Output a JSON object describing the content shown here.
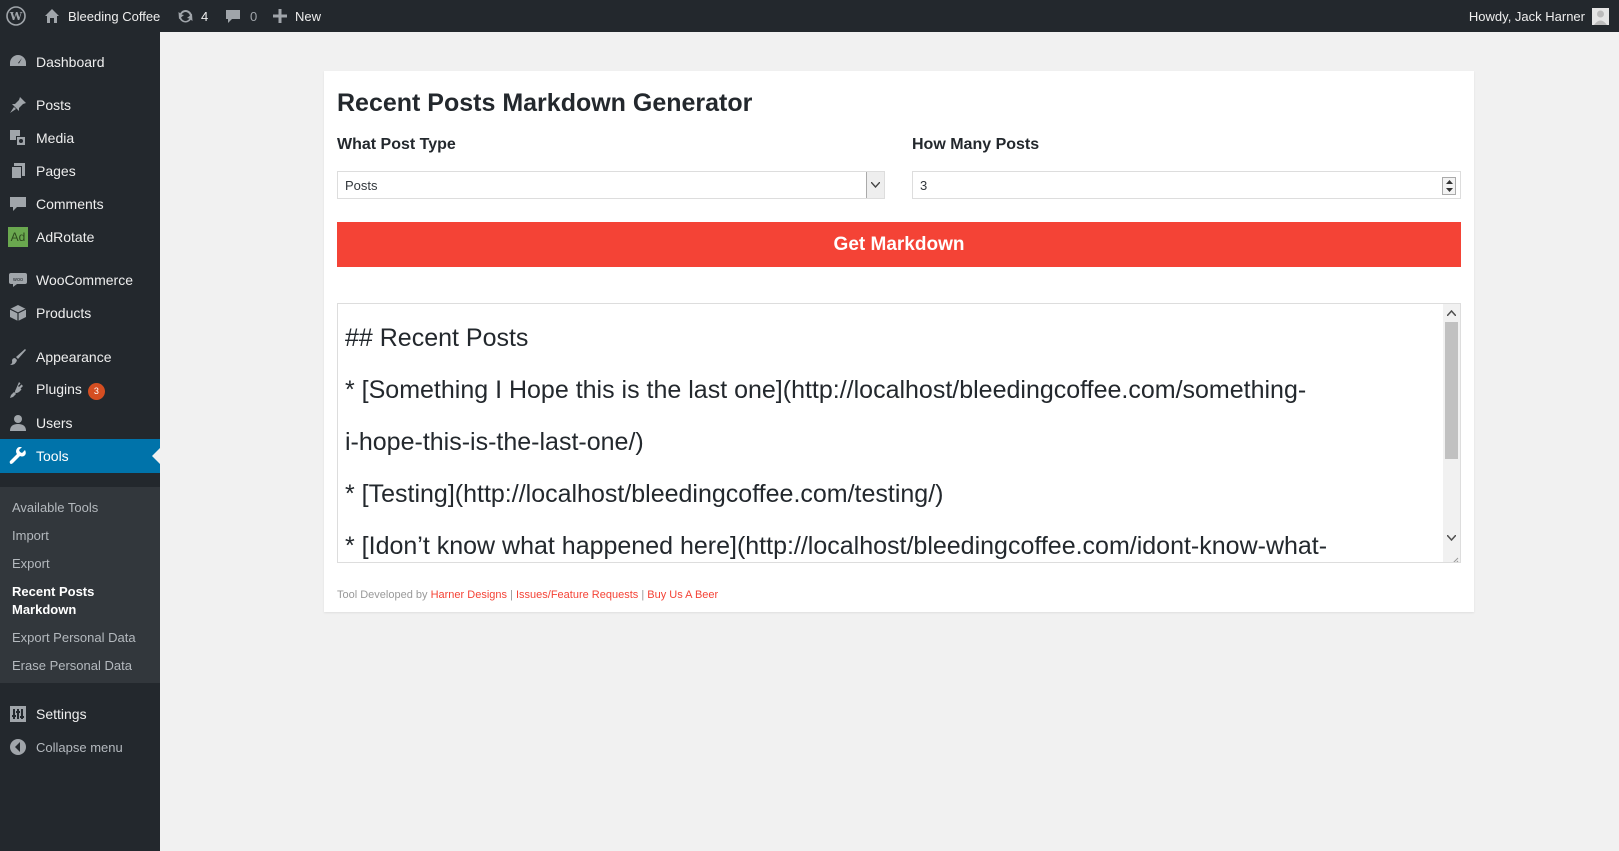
{
  "adminbar": {
    "site_name": "Bleeding Coffee",
    "updates_count": "4",
    "comments_count": "0",
    "new_label": "New",
    "greeting": "Howdy, Jack Harner"
  },
  "sidebar": {
    "items": [
      {
        "label": "Dashboard",
        "icon": "dashboard-icon"
      },
      {
        "label": "Posts",
        "icon": "pin-icon"
      },
      {
        "label": "Media",
        "icon": "media-icon"
      },
      {
        "label": "Pages",
        "icon": "pages-icon"
      },
      {
        "label": "Comments",
        "icon": "comment-icon"
      },
      {
        "label": "AdRotate",
        "icon": "adrotate-icon"
      },
      {
        "label": "WooCommerce",
        "icon": "woocommerce-icon"
      },
      {
        "label": "Products",
        "icon": "box-icon"
      },
      {
        "label": "Appearance",
        "icon": "brush-icon"
      },
      {
        "label": "Plugins",
        "icon": "plug-icon",
        "badge": "3"
      },
      {
        "label": "Users",
        "icon": "user-icon"
      },
      {
        "label": "Tools",
        "icon": "wrench-icon",
        "current": true
      },
      {
        "label": "Settings",
        "icon": "settings-icon"
      },
      {
        "label": "Collapse menu",
        "icon": "collapse-icon"
      }
    ],
    "submenu": [
      {
        "label": "Available Tools"
      },
      {
        "label": "Import"
      },
      {
        "label": "Export"
      },
      {
        "label": "Recent Posts Markdown",
        "current": true
      },
      {
        "label": "Export Personal Data"
      },
      {
        "label": "Erase Personal Data"
      }
    ]
  },
  "tool": {
    "title": "Recent Posts Markdown Generator",
    "post_type_label": "What Post Type",
    "post_type_value": "Posts",
    "count_label": "How Many Posts",
    "count_value": "3",
    "button_label": "Get Markdown",
    "output_text": "## Recent Posts\n* [Something I Hope this is the last one](http://localhost/bleedingcoffee.com/something-\ni-hope-this-is-the-last-one/)\n* [Testing](http://localhost/bleedingcoffee.com/testing/)\n* [Idon’t know what happened here](http://localhost/bleedingcoffee.com/idont-know-what-",
    "footer_prefix": "Tool Developed by",
    "footer_links": [
      "Harner Designs",
      "Issues/Feature Requests",
      "Buy Us A Beer"
    ],
    "footer_sep": "|"
  },
  "colors": {
    "accent": "#f44336",
    "admin_dark": "#23282d",
    "current_blue": "#0073aa"
  }
}
